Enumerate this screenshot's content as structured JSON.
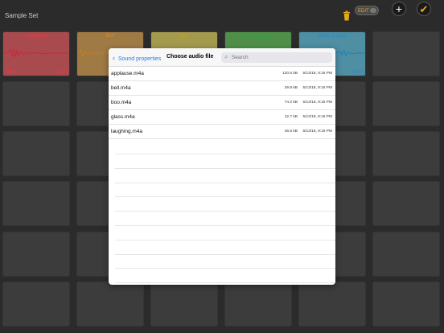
{
  "header": {
    "set_title": "Sample Set",
    "edit_label": "EDIT"
  },
  "pads": [
    {
      "name": "Applause",
      "t_start": "0:00.0",
      "t_end": "0:07.1",
      "color": "#a94b4e",
      "text_color": "#e23b47"
    },
    {
      "name": "Bell",
      "color": "#a07a45",
      "text_color": "#d28a2a"
    },
    {
      "name": "Boo",
      "color": "#a39a4d",
      "text_color": "#c2a11f"
    },
    {
      "name": "Broken Glass",
      "color": "#4f8f4a",
      "text_color": "#2fa24b"
    },
    {
      "name": "Witch Laugh",
      "t_end": "0:03.5",
      "color": "#4e8fa4",
      "text_color": "#2b87bd"
    }
  ],
  "modal": {
    "back_label": "Sound properties",
    "title": "Choose audio file",
    "search_placeholder": "Search",
    "files": [
      {
        "name": "applause.m4a",
        "size": "120.6 kB",
        "date": "5/13/18, 9:16 PM"
      },
      {
        "name": "bell.m4a",
        "size": "29.8 kB",
        "date": "5/13/18, 9:16 PM"
      },
      {
        "name": "boo.m4a",
        "size": "74.2 kB",
        "date": "5/13/18, 9:16 PM"
      },
      {
        "name": "glass.m4a",
        "size": "12.7 kB",
        "date": "5/13/18, 9:16 PM"
      },
      {
        "name": "laughing.m4a",
        "size": "46.5 kB",
        "date": "5/13/18, 9:16 PM"
      }
    ]
  },
  "icons": {
    "trash": "trash-icon",
    "add": "plus-icon",
    "done": "checkmark-icon"
  }
}
